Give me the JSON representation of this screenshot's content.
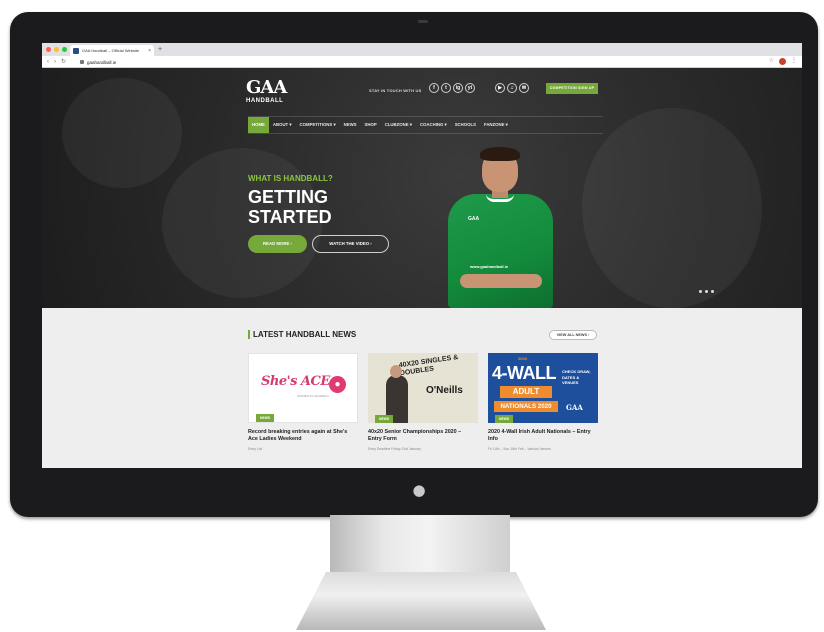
{
  "browser": {
    "tab_title": "GAA Handball – Official Website",
    "tab_close": "×",
    "new_tab": "+",
    "nav_buttons": [
      "‹",
      "›",
      "↻"
    ],
    "url": "gaahandball.ie",
    "menu": "⋮"
  },
  "header": {
    "logo_text": "GAA",
    "logo_sub": "HANDBALL",
    "social_label": "STAY IN TOUCH WITH US",
    "social_icons": [
      "f",
      "t",
      "ig",
      "yt",
      "▶",
      "♫",
      "✉"
    ],
    "cta": "COMPETITION SIGN UP"
  },
  "nav": {
    "items": [
      "HOME",
      "ABOUT ▾",
      "COMPETITIONS ▾",
      "NEWS",
      "SHOP",
      "CLUBZONE ▾",
      "COACHING ▾",
      "SCHOOLS",
      "FANZONE ▾"
    ],
    "active": "HOME"
  },
  "hero": {
    "kicker": "WHAT IS HANDBALL?",
    "headline": "GETTING STARTED",
    "read_more": "READ MORE ›",
    "watch_video": "WATCH THE VIDEO ›",
    "jersey_logo": "GAA",
    "jersey_text": "www.gaahandball.ie"
  },
  "news": {
    "title": "LATEST HANDBALL NEWS",
    "view_all": "VIEW ALL NEWS ›",
    "cards": [
      {
        "tag": "NEWS",
        "image_title": "She's ACE",
        "image_sub": "WOMEN IN HANDBALL",
        "title": "Record breaking entries again at She's Ace Ladies Weekend",
        "meta": "Entry List"
      },
      {
        "tag": "NEWS",
        "image_title": "40X20 SINGLES & DOUBLES",
        "image_brand": "O'Neills",
        "title": "40x20 Senior Championships 2020 – Entry Form",
        "meta": "Entry Deadline Friday 31st January"
      },
      {
        "tag": "NEWS",
        "image_top": "2020",
        "image_big": "4-WALL",
        "image_mid": "ADULT",
        "image_nat": "NATIONALS 2020",
        "image_side": "CHECK DRAW, DATES & VENUES",
        "image_gaa": "GAA",
        "title": "2020 4-Wall Irish Adult Nationals – Entry Info",
        "meta": "Fri 14th – Sun 16th Feb – Various Venues"
      }
    ]
  },
  "colors": {
    "accent": "#76a83a",
    "kicker": "#8dc63f",
    "hero_bg": "#2c2c2c",
    "news_bg": "#eeeeee"
  }
}
